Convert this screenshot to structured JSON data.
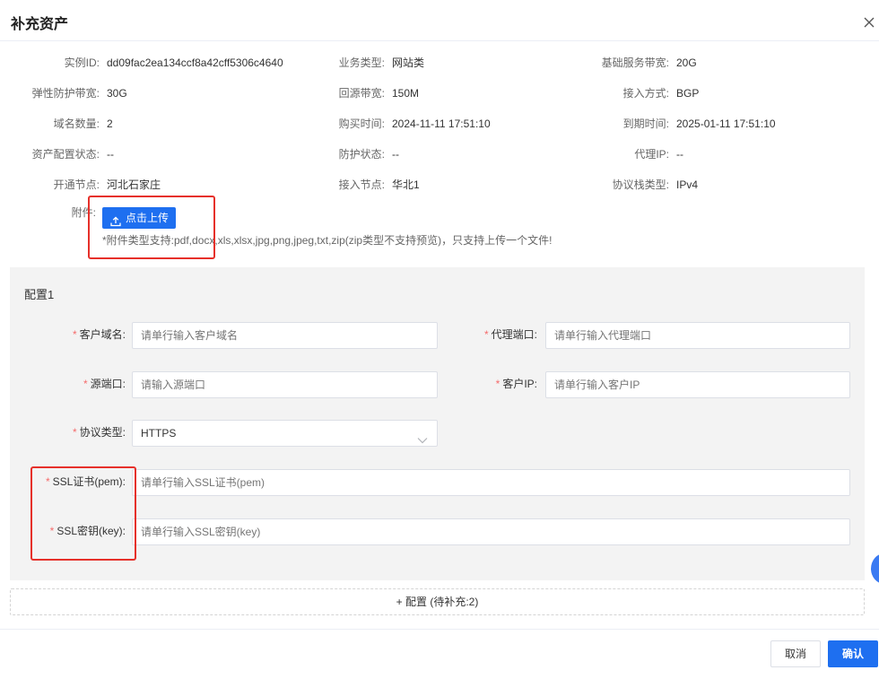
{
  "dialog": {
    "title": "补充资产",
    "close_icon": "close-icon"
  },
  "info": {
    "row1": {
      "instance_id_label": "实例ID:",
      "instance_id": "dd09fac2ea134ccf8a42cff5306c4640",
      "biz_type_label": "业务类型:",
      "biz_type": "网站类",
      "base_bw_label": "基础服务带宽:",
      "base_bw": "20G"
    },
    "row2": {
      "elastic_bw_label": "弹性防护带宽:",
      "elastic_bw": "30G",
      "origin_bw_label": "回源带宽:",
      "origin_bw": "150M",
      "access_mode_label": "接入方式:",
      "access_mode": "BGP"
    },
    "row3": {
      "domain_count_label": "域名数量:",
      "domain_count": "2",
      "purchase_time_label": "购买时间:",
      "purchase_time": "2024-11-11 17:51:10",
      "expire_time_label": "到期时间:",
      "expire_time": "2025-01-11 17:51:10"
    },
    "row4": {
      "config_status_label": "资产配置状态:",
      "config_status": "--",
      "protect_status_label": "防护状态:",
      "protect_status": "--",
      "proxy_ip_label": "代理IP:",
      "proxy_ip": "--"
    },
    "row5": {
      "open_node_label": "开通节点:",
      "open_node": "河北石家庄",
      "access_node_label": "接入节点:",
      "access_node": "华北1",
      "protocol_stack_label": "协议栈类型:",
      "protocol_stack": "IPv4"
    }
  },
  "attachment": {
    "label": "附件:",
    "upload_label": "点击上传",
    "hint": "*附件类型支持:pdf,docx,xls,xlsx,jpg,png,jpeg,txt,zip(zip类型不支持预览)，只支持上传一个文件!"
  },
  "config": {
    "title": "配置1",
    "required_mark": "*",
    "customer_domain": {
      "label": "客户域名:",
      "placeholder": "请单行输入客户域名"
    },
    "proxy_port": {
      "label": "代理端口:",
      "placeholder": "请单行输入代理端口"
    },
    "source_port": {
      "label": "源端口:",
      "placeholder": "请输入源端口"
    },
    "customer_ip": {
      "label": "客户IP:",
      "placeholder": "请单行输入客户IP"
    },
    "protocol_type": {
      "label": "协议类型:",
      "value": "HTTPS"
    },
    "ssl_cert": {
      "label": "SSL证书(pem):",
      "placeholder": "请单行输入SSL证书(pem)"
    },
    "ssl_key": {
      "label": "SSL密钥(key):",
      "placeholder": "请单行输入SSL密钥(key)"
    }
  },
  "add_config_label": "+ 配置 (待补充:2)",
  "footer": {
    "cancel_label": "取消",
    "confirm_label": "确认"
  },
  "colors": {
    "primary": "#1e6ff0",
    "highlight_box": "#e6302a",
    "required": "#f56c6c"
  }
}
